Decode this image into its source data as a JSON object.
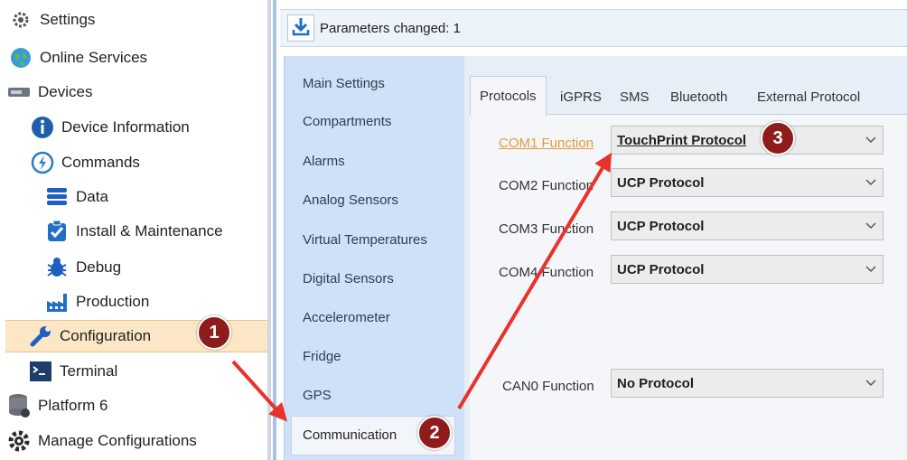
{
  "tree": {
    "items": [
      {
        "label": "Settings",
        "icon": "gear-icon"
      },
      {
        "label": "Online Services",
        "icon": "globe-icon"
      },
      {
        "label": "Devices",
        "icon": "device-icon"
      },
      {
        "label": "Device Information",
        "icon": "info-icon"
      },
      {
        "label": "Commands",
        "icon": "commands-icon"
      },
      {
        "label": "Data",
        "icon": "database-icon"
      },
      {
        "label": "Install & Maintenance",
        "icon": "clipboard-check-icon"
      },
      {
        "label": "Debug",
        "icon": "bug-icon"
      },
      {
        "label": "Production",
        "icon": "factory-icon"
      },
      {
        "label": "Configuration",
        "icon": "wrench-icon"
      },
      {
        "label": "Terminal",
        "icon": "terminal-icon"
      },
      {
        "label": "Platform 6",
        "icon": "server-icon"
      },
      {
        "label": "Manage Configurations",
        "icon": "gear-icon"
      }
    ]
  },
  "toolbar": {
    "params_changed": "Parameters changed: 1"
  },
  "settings": {
    "items": [
      {
        "label": "Main Settings"
      },
      {
        "label": "Compartments"
      },
      {
        "label": "Alarms"
      },
      {
        "label": "Analog Sensors"
      },
      {
        "label": "Virtual Temperatures"
      },
      {
        "label": "Digital Sensors"
      },
      {
        "label": "Accelerometer"
      },
      {
        "label": "Fridge"
      },
      {
        "label": "GPS"
      },
      {
        "label": "Communication"
      }
    ]
  },
  "tabs": [
    {
      "label": "Protocols"
    },
    {
      "label": "iGPRS"
    },
    {
      "label": "SMS"
    },
    {
      "label": "Bluetooth"
    },
    {
      "label": "External Protocol"
    }
  ],
  "fields": [
    {
      "label": "COM1 Function",
      "value": "TouchPrint Protocol"
    },
    {
      "label": "COM2 Function",
      "value": "UCP Protocol"
    },
    {
      "label": "COM3 Function",
      "value": "UCP Protocol"
    },
    {
      "label": "COM4 Function",
      "value": "UCP Protocol"
    },
    {
      "label": "CAN0 Function",
      "value": "No Protocol"
    }
  ],
  "callouts": {
    "one": "1",
    "two": "2",
    "three": "3"
  },
  "colors": {
    "callout": "#8f1c1c",
    "arrow": "#e8322c",
    "selection": "#fbe6c5",
    "highlight_label": "#e59a3c"
  }
}
